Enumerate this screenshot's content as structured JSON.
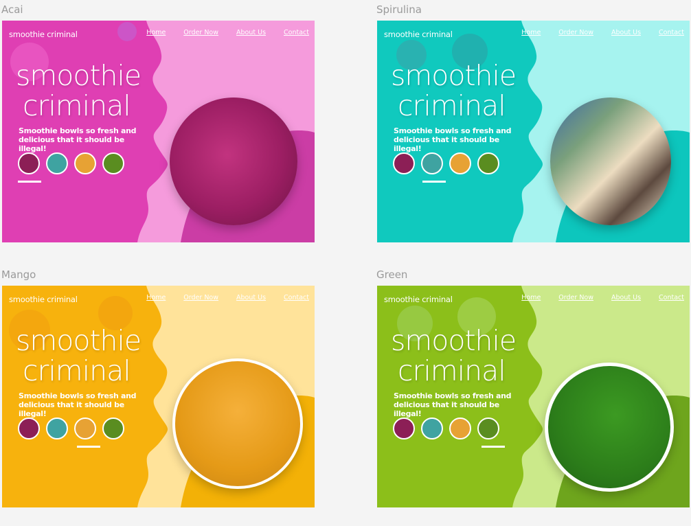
{
  "logo_small": "smoothie criminal",
  "nav": [
    "Home",
    "Order Now",
    "About Us",
    "Contact"
  ],
  "logo_line1": "smoothie",
  "logo_line2": "criminal",
  "tagline": "Smoothie bowls so fresh and delicious that it should be illegal!",
  "variants": [
    {
      "label": "Acai",
      "active": 0,
      "colors": {
        "left": "#df3fb3",
        "right": "#f59bdc",
        "blob": "#cb3da5",
        "bowl": "#a11f6a"
      }
    },
    {
      "label": "Spirulina",
      "active": 1,
      "colors": {
        "left": "#10c9be",
        "right": "#a6f3ef",
        "blob": "#0dc6bd",
        "bowl": "#2a7a80"
      }
    },
    {
      "label": "Mango",
      "active": 2,
      "colors": {
        "left": "#f7b20d",
        "right": "#ffe39a",
        "blob": "#f3b107",
        "bowl": "#e3a526"
      }
    },
    {
      "label": "Green",
      "active": 3,
      "colors": {
        "left": "#8cbf1a",
        "right": "#cbe98a",
        "blob": "#6ea51d",
        "bowl": "#4f8d20"
      }
    }
  ],
  "thumb_colors": [
    "#8c1f56",
    "#3fa3a1",
    "#e7a234",
    "#5a8d20"
  ]
}
